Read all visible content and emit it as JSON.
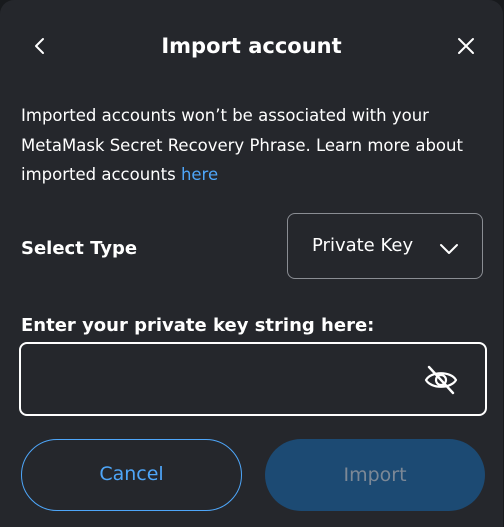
{
  "header": {
    "title": "Import account",
    "back_icon": "chevron-left-icon",
    "close_icon": "close-icon"
  },
  "description": {
    "line1": "Imported accounts won’t be associated with your",
    "line2": "MetaMask Secret Recovery Phrase. Learn more about",
    "line3": "imported accounts ",
    "link": "here"
  },
  "select_type": {
    "label": "Select Type",
    "value": "Private Key",
    "icon": "chevron-down-icon"
  },
  "private_key": {
    "label": "Enter your private key string here:",
    "value": "",
    "visibility_icon": "eye-slash-icon"
  },
  "actions": {
    "cancel_label": "Cancel",
    "import_label": "Import"
  },
  "colors": {
    "background": "#25272c",
    "link": "#4ea6f9",
    "primary_disabled": "#1c4a73",
    "border": "#8a8d93"
  }
}
